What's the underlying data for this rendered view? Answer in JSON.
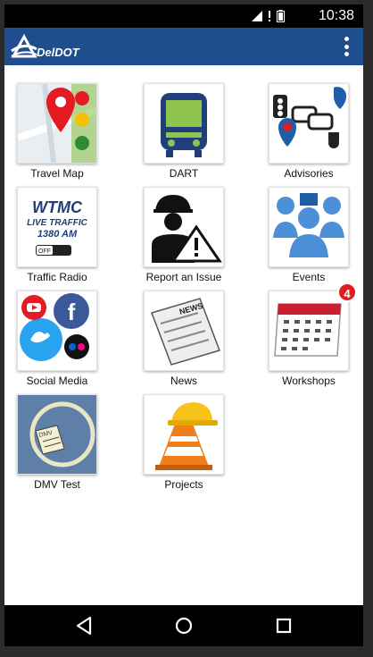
{
  "status": {
    "time": "10:38"
  },
  "app": {
    "brand": "DelDOT"
  },
  "tiles": [
    {
      "label": "Travel Map"
    },
    {
      "label": "DART"
    },
    {
      "label": "Advisories"
    },
    {
      "label": "Traffic Radio",
      "radio_lines": [
        "WTMC",
        "LIVE TRAFFIC",
        "1380 AM",
        "OFF"
      ]
    },
    {
      "label": "Report an Issue"
    },
    {
      "label": "Events"
    },
    {
      "label": "Social Media"
    },
    {
      "label": "News",
      "paper_text": "NEWS"
    },
    {
      "label": "Workshops",
      "badge": "4"
    },
    {
      "label": "DMV Test",
      "card_text": "DMV"
    },
    {
      "label": "Projects"
    }
  ],
  "colors": {
    "appbar": "#1f4e8f",
    "badge": "#e31b23"
  }
}
